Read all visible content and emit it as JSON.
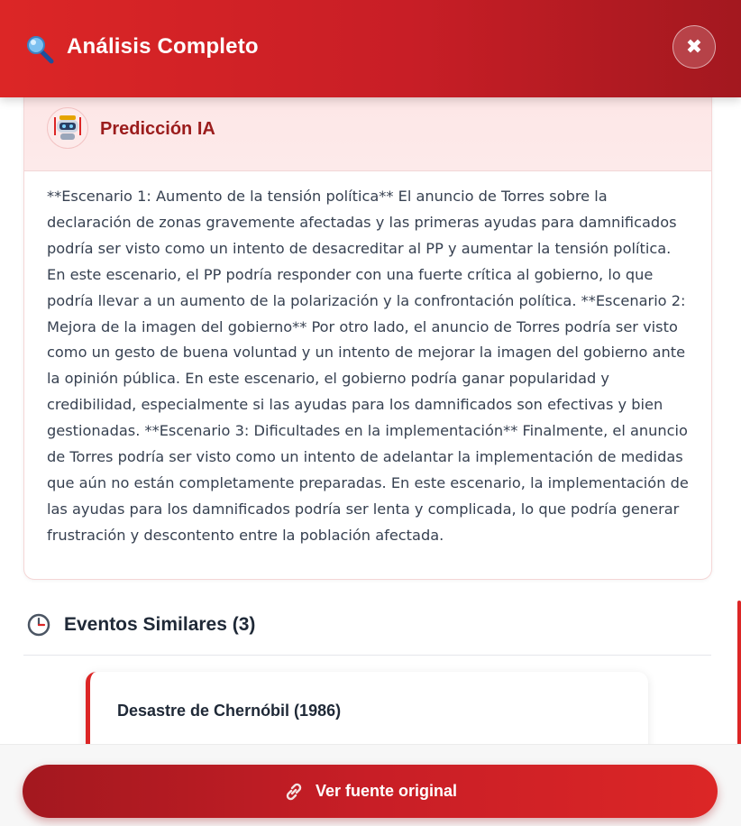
{
  "header": {
    "title": "Análisis Completo",
    "close_label": "✖",
    "icon": "magnifier-icon"
  },
  "prediction": {
    "title": "Predicción IA",
    "icon": "robot-icon",
    "text": "**Escenario 1: Aumento de la tensión política** El anuncio de Torres sobre la declaración de zonas gravemente afectadas y las primeras ayudas para damnificados podría ser visto como un intento de desacreditar al PP y aumentar la tensión política. En este escenario, el PP podría responder con una fuerte crítica al gobierno, lo que podría llevar a un aumento de la polarización y la confrontación política. **Escenario 2: Mejora de la imagen del gobierno** Por otro lado, el anuncio de Torres podría ser visto como un gesto de buena voluntad y un intento de mejorar la imagen del gobierno ante la opinión pública. En este escenario, el gobierno podría ganar popularidad y credibilidad, especialmente si las ayudas para los damnificados son efectivas y bien gestionadas. **Escenario 3: Dificultades en la implementación** Finalmente, el anuncio de Torres podría ser visto como un intento de adelantar la implementación de medidas que aún no están completamente preparadas. En este escenario, la implementación de las ayudas para los damnificados podría ser lenta y complicada, lo que podría generar frustración y descontento entre la población afectada."
  },
  "similar": {
    "title": "Eventos Similares (3)",
    "icon": "clock-icon",
    "events": [
      {
        "title": "Desastre de Chernóbil (1986)"
      }
    ]
  },
  "footer": {
    "button_label": "Ver fuente original",
    "icon": "link-icon"
  },
  "colors": {
    "accent": "#dc2626",
    "accent_dark": "#a3181f",
    "card_head_bg": "#fde6e6"
  }
}
